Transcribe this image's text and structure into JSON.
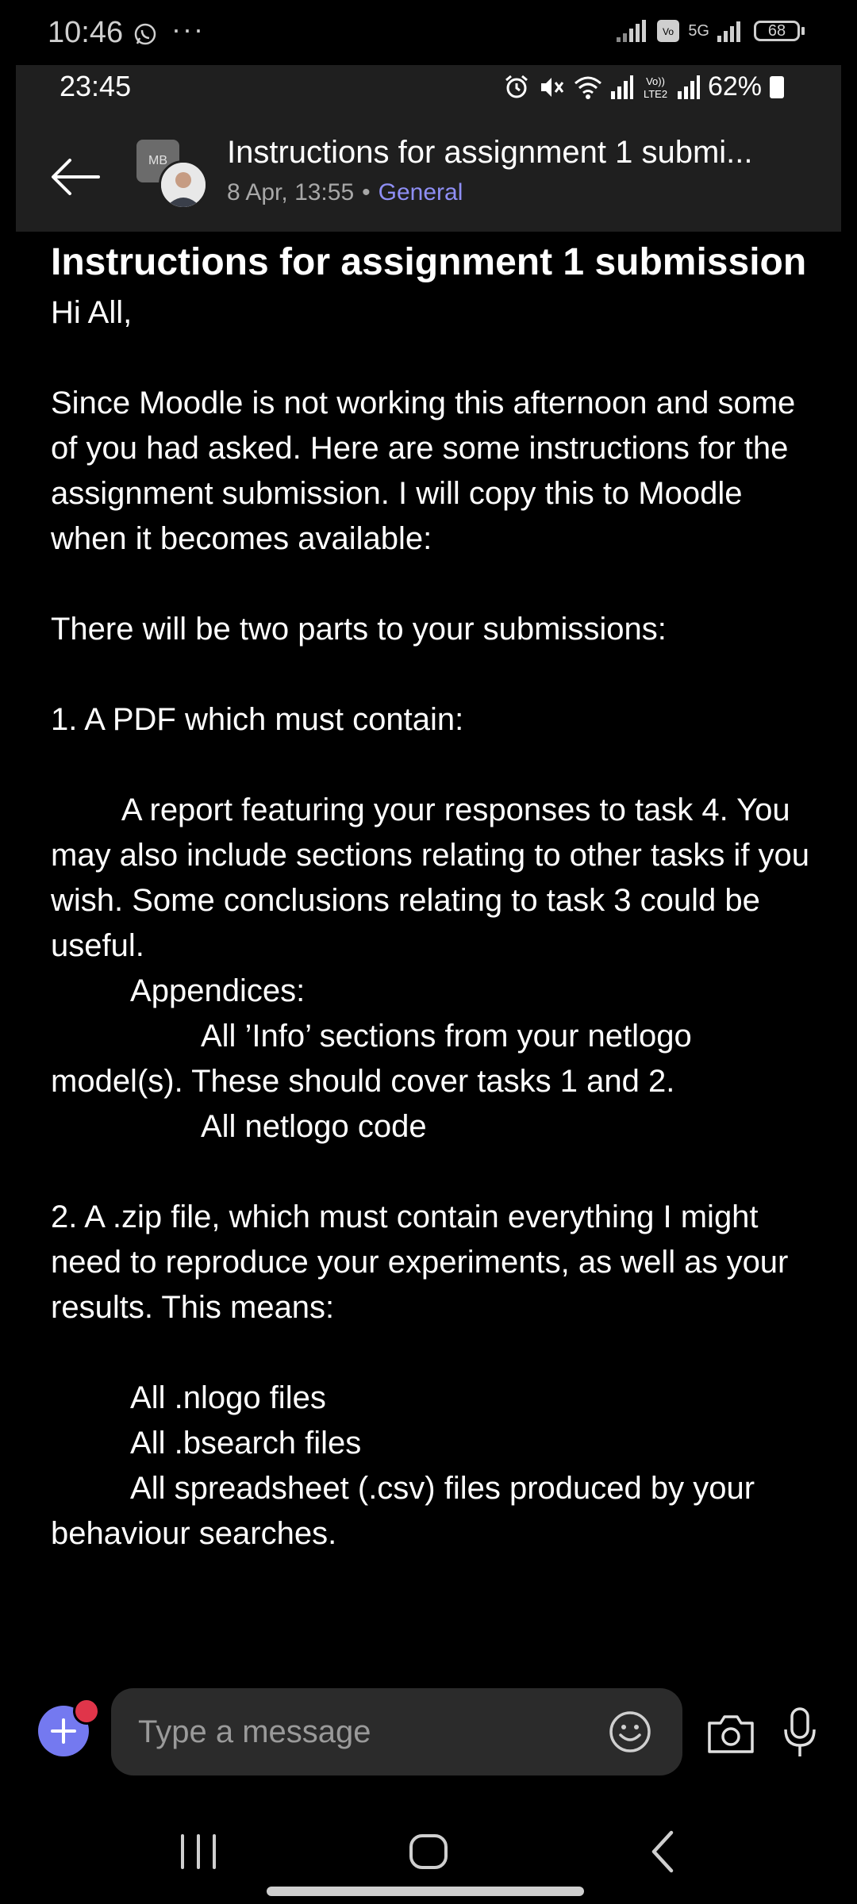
{
  "outer_status": {
    "time": "10:46",
    "dots": "···",
    "network_label": "5G",
    "battery": "68"
  },
  "inner_status": {
    "time": "23:45",
    "battery": "62%"
  },
  "header": {
    "title": "Instructions for assignment 1 submi...",
    "date": "8 Apr, 13:55",
    "separator": "•",
    "channel": "General",
    "team_initials": "MB"
  },
  "post": {
    "title": "Instructions for assignment 1 submission",
    "body": "Hi All,\n\nSince Moodle is not working this afternoon and some of you had asked. Here are some instructions for the assignment submission. I will copy this to Moodle when it becomes available:\n\nThere will be two parts to your submissions:\n\n1. A PDF which must contain:\n\n        A report featuring your responses to task 4. You may also include sections relating to other tasks if you wish. Some conclusions relating to task 3 could be useful.\n         Appendices:\n                 All ’Info’ sections from your netlogo model(s). These should cover tasks 1 and 2.\n                 All netlogo code\n\n2. A .zip file, which must contain everything I might need to reproduce your experiments, as well as your results. This means:\n\n         All .nlogo files\n         All .bsearch files\n         All spreadsheet (.csv) files produced by your behaviour searches."
  },
  "composer": {
    "placeholder": "Type a message",
    "add_icon": "plus-icon",
    "emoji_icon": "emoji-icon",
    "camera_icon": "camera-icon",
    "mic_icon": "microphone-icon"
  },
  "colors": {
    "background": "#000000",
    "header_bg": "#1f1f1f",
    "accent": "#7479f0",
    "channel": "#8f8ff5",
    "badge": "#e0354a"
  }
}
